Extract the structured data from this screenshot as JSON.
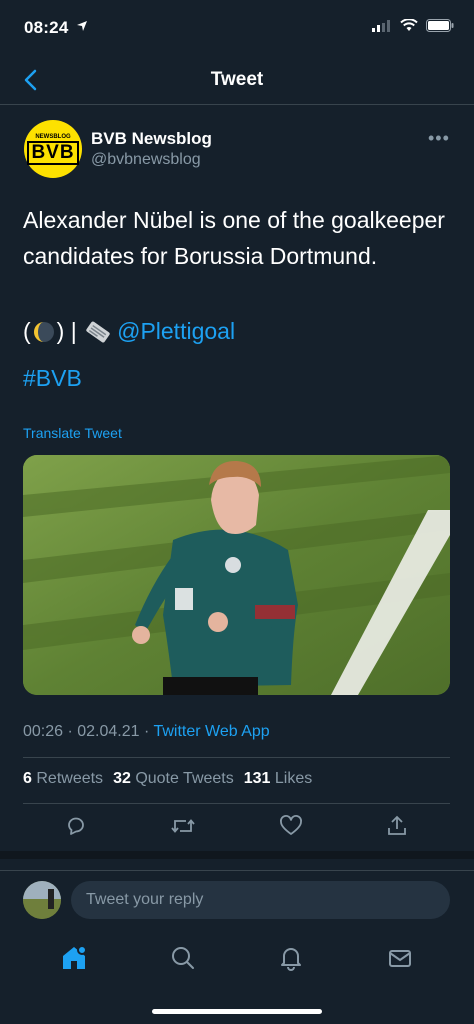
{
  "status_bar": {
    "time": "08:24"
  },
  "nav": {
    "title": "Tweet"
  },
  "author": {
    "name": "BVB Newsblog",
    "handle": "@bvbnewsblog",
    "avatar_text": "BVB",
    "avatar_subtext": "NEWSBLOG"
  },
  "tweet": {
    "text": "Alexander Nübel is one of the goalkeeper candidates for Borussia Dortmund.",
    "mention_prefix_open": "(",
    "mention_prefix_close": ") | ",
    "mention": "@Plettigoal",
    "hashtag": "#BVB",
    "translate_label": "Translate Tweet",
    "timestamp": "00:26 · 02.04.21 · ",
    "source": "Twitter Web App"
  },
  "stats": {
    "retweets_count": "6",
    "retweets_label": "Retweets",
    "quotes_count": "32",
    "quotes_label": "Quote Tweets",
    "likes_count": "131",
    "likes_label": "Likes"
  },
  "reply": {
    "placeholder": "Tweet your reply"
  },
  "colors": {
    "background": "#15202b",
    "accent": "#1da1f2",
    "muted": "#8899a6",
    "divider": "#38444d"
  }
}
